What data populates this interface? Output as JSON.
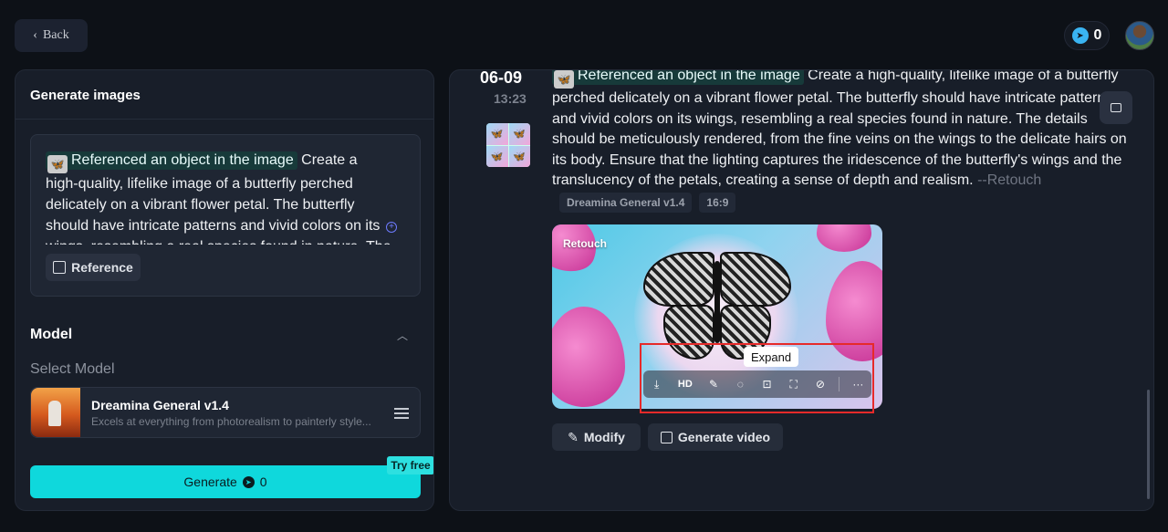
{
  "header": {
    "back_label": "Back",
    "credits": "0"
  },
  "left_panel": {
    "title": "Generate images",
    "prompt": {
      "reference_chip": "Referenced an object in the image",
      "text": "Create a high-quality, lifelike image of a butterfly perched delicately on a vibrant flower petal. The butterfly should have intricate patterns and vivid colors on its wings, resembling a real species found in nature. The details should"
    },
    "reference_button": "Reference",
    "model_title": "Model",
    "select_model_label": "Select Model",
    "model": {
      "name": "Dreamina General v1.4",
      "description": "Excels at everything from photorealism to painterly style..."
    },
    "try_free_badge": "Try free",
    "generate_label": "Generate",
    "generate_cost": "0"
  },
  "result": {
    "date": "06-09",
    "time": "13:23",
    "reference_chip": "Referenced an object in the image",
    "prompt_text": "Create a high-quality, lifelike image of a butterfly perched delicately on a vibrant flower petal. The butterfly should have intricate patterns and vivid colors on its wings, resembling a real species found in nature. The details should be meticulously rendered, from the fine veins on the wings to the delicate hairs on its body. Ensure that the lighting captures the iridescence of the butterfly's wings and the translucency of the petals, creating a sense of depth and realism.",
    "prompt_suffix": "--Retouch",
    "tags": [
      "Dreamina General v1.4",
      "16:9"
    ],
    "image_label": "Retouch",
    "toolbar": {
      "hd_label": "HD",
      "tooltip": "Expand",
      "icons": [
        "download-icon",
        "hd-icon",
        "magic-wand-icon",
        "eraser-icon",
        "expand-icon",
        "crop-icon",
        "bandage-icon",
        "more-icon"
      ]
    },
    "modify_label": "Modify",
    "generate_video_label": "Generate video"
  },
  "colors": {
    "accent": "#0fd8dc",
    "highlight": "#e62a2a",
    "panel": "#181e29",
    "background": "#0d1117"
  }
}
